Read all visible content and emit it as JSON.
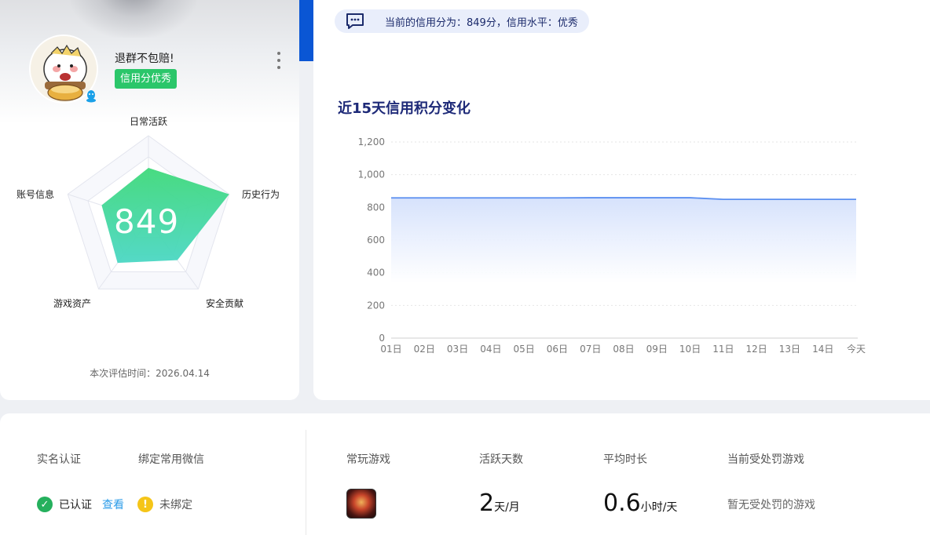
{
  "profile": {
    "username": "退群不包赔!",
    "credit_tag": "信用分优秀",
    "score": "849",
    "eval_time": "本次评估时间：2026.04.14"
  },
  "radar": {
    "axes": [
      "日常活跃",
      "历史行为",
      "安全贡献",
      "游戏资产",
      "账号信息"
    ],
    "values": [
      0.62,
      1.0,
      0.58,
      0.62,
      0.58
    ]
  },
  "notice": {
    "text": "当前的信用分为：849分，信用水平：优秀"
  },
  "chart_title": "近15天信用积分变化",
  "chart_data": {
    "type": "area",
    "title": "近15天信用积分变化",
    "x": [
      "01日",
      "02日",
      "03日",
      "04日",
      "05日",
      "06日",
      "07日",
      "08日",
      "09日",
      "10日",
      "11日",
      "12日",
      "13日",
      "14日",
      "今天"
    ],
    "series": [
      {
        "values": [
          858,
          858,
          858,
          858,
          858,
          858,
          859,
          859,
          859,
          859,
          849,
          849,
          849,
          849,
          849
        ]
      }
    ],
    "ylim": [
      0,
      1200
    ],
    "yticks": [
      "0",
      "200",
      "400",
      "600",
      "800",
      "1,000",
      "1,200"
    ],
    "grid": true,
    "colors": {
      "line": "#5b8ff0",
      "fill": "#dce6fd"
    }
  },
  "bottom": {
    "realname_label": "实名认证",
    "wechat_label": "绑定常用微信",
    "realname_status": "已认证",
    "view_link": "查看",
    "wechat_status": "未绑定",
    "fav_game_label": "常玩游戏",
    "active_days_label": "活跃天数",
    "avg_time_label": "平均时长",
    "punish_label": "当前受处罚游戏",
    "active_days_value": "2",
    "active_days_unit": "天/月",
    "avg_time_value": "0.6",
    "avg_time_unit": "小时/天",
    "no_punish_text": "暂无受处罚的游戏"
  },
  "icons": [
    "more-vertical-icon",
    "message-icon",
    "check-circle-icon",
    "warning-circle-icon",
    "qq-icon",
    "game-icon"
  ]
}
